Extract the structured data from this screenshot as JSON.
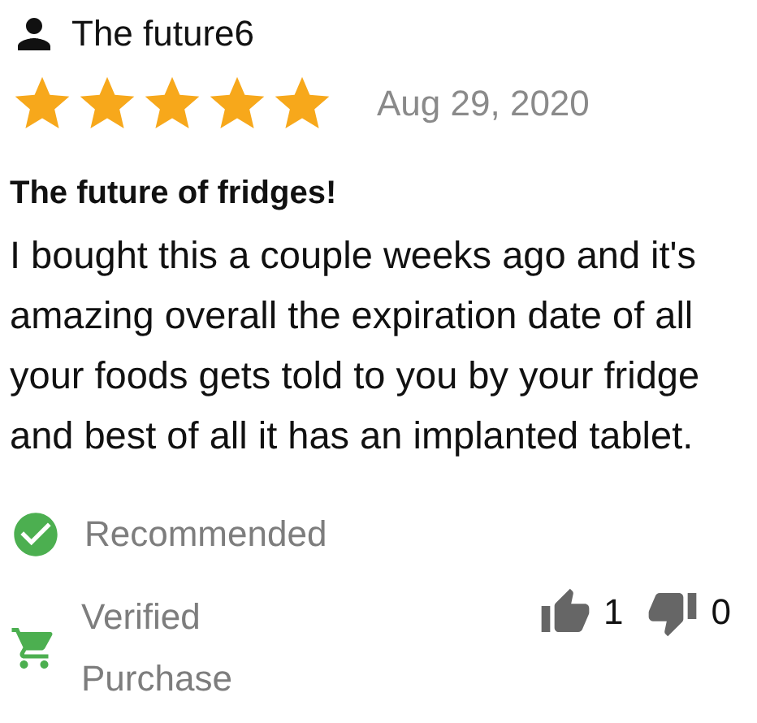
{
  "reviewer": {
    "name": "The future6"
  },
  "rating": {
    "stars": 5,
    "date": "Aug 29, 2020"
  },
  "review": {
    "title": "The future of fridges!",
    "body": "I bought this a couple weeks ago and it's amazing overall the expiration date of all your foods gets told to you by your fridge and best of all it has an implanted tablet."
  },
  "recommendation": {
    "label": "Recommended"
  },
  "verified": {
    "label": "Verified Purchase"
  },
  "votes": [
    {
      "kind": "up",
      "count": "1"
    },
    {
      "kind": "down",
      "count": "0"
    }
  ]
}
